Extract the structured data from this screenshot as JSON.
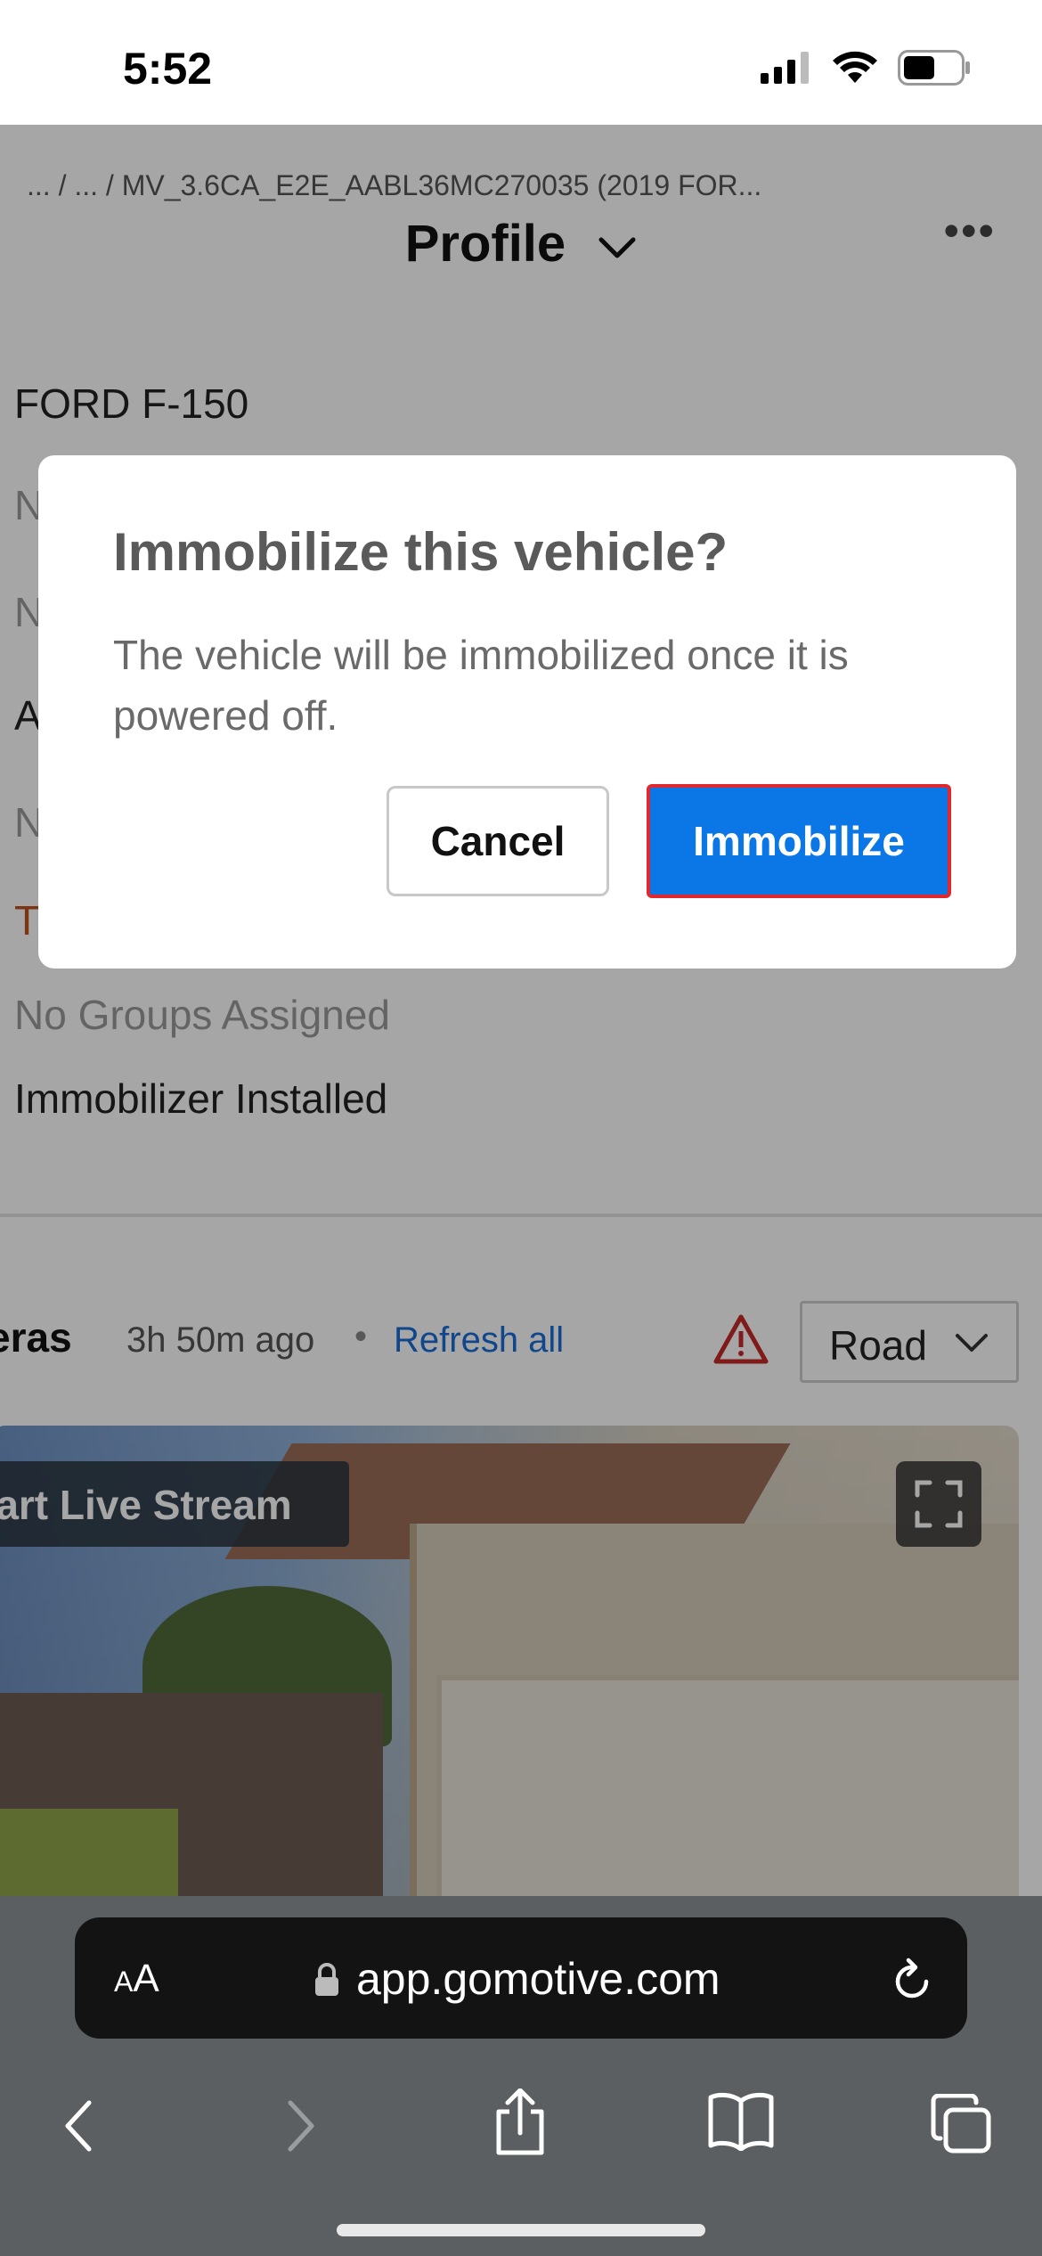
{
  "status_bar": {
    "time": "5:52"
  },
  "page": {
    "breadcrumb": "... / ... / MV_3.6CA_E2E_AABL36MC270035 (2019 FOR...",
    "title": "Profile",
    "vehicle_model": "FORD F-150",
    "partial_rows": [
      "N",
      "N",
      "A",
      "N",
      "T"
    ],
    "groups": "No Groups Assigned",
    "immobilizer_status": "Immobilizer Installed"
  },
  "cameras": {
    "title": "eras",
    "time_ago": "3h 50m ago",
    "separator": "•",
    "refresh_all": "Refresh all",
    "view_select": "Road",
    "live_stream": "tart Live Stream"
  },
  "modal": {
    "title": "Immobilize this vehicle?",
    "body": "The vehicle will be immobilized once it is powered off.",
    "cancel_label": "Cancel",
    "confirm_label": "Immobilize",
    "confirm_color": "#0b77e6"
  },
  "browser": {
    "aa_label_small": "A",
    "aa_label_big": "A",
    "url": "app.gomotive.com"
  }
}
